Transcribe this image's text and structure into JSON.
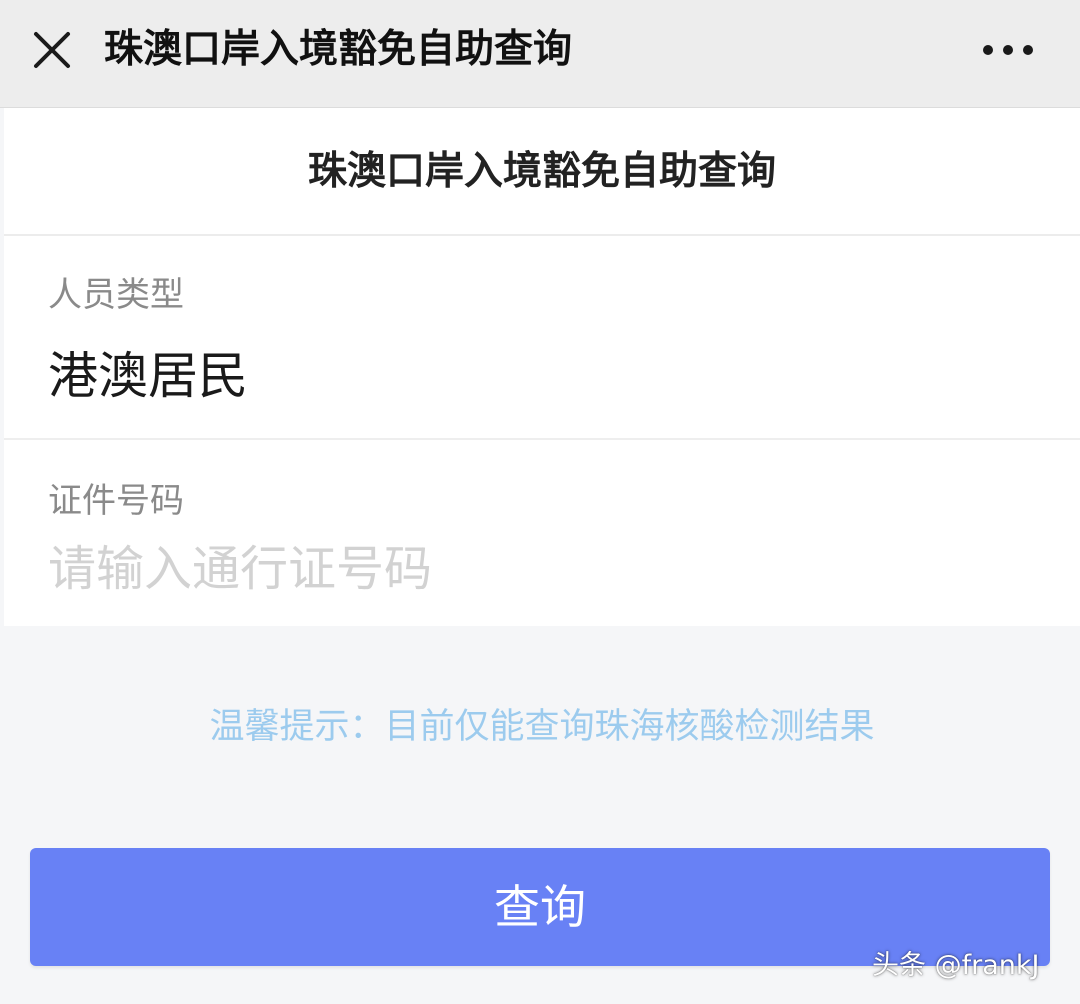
{
  "titlebar": {
    "title": "珠澳口岸入境豁免自助查询",
    "close_icon": "close-icon",
    "more_icon": "more-dots-icon"
  },
  "page": {
    "title": "珠澳口岸入境豁免自助查询"
  },
  "form": {
    "person_type": {
      "label": "人员类型",
      "value": "港澳居民",
      "icon": "chevron-right-icon"
    },
    "id_number": {
      "label": "证件号码",
      "value": "",
      "placeholder": "请输入通行证号码"
    }
  },
  "tip": "温馨提示：目前仅能查询珠海核酸检测结果",
  "query_button": {
    "label": "查询"
  },
  "watermark": "头条 @frankJ",
  "colors": {
    "accent": "#6881f5",
    "tip": "#9ccbee",
    "titlebar_bg": "#ededed",
    "page_bg": "#f5f6f8"
  }
}
